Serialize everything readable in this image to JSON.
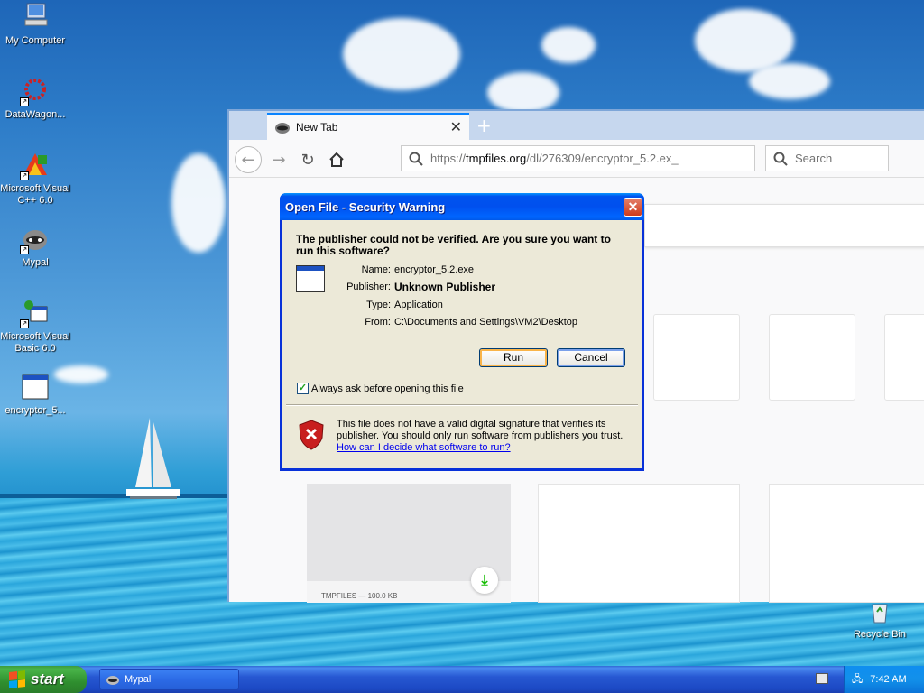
{
  "desktop": {
    "icons": [
      {
        "label": "My Computer",
        "icon": "my-computer-icon"
      },
      {
        "label": "DataWagon...",
        "icon": "datawagon-icon"
      },
      {
        "label": "Microsoft Visual C++ 6.0",
        "icon": "visual-cpp-icon"
      },
      {
        "label": "Mypal",
        "icon": "mypal-icon"
      },
      {
        "label": "Microsoft Visual Basic 6.0",
        "icon": "visual-basic-icon"
      },
      {
        "label": "encryptor_5...",
        "icon": "executable-icon"
      },
      {
        "label": "Recycle Bin",
        "icon": "recycle-bin-icon"
      }
    ]
  },
  "browser": {
    "tab_title": "New Tab",
    "url_prefix": "https://",
    "url_host": "tmpfiles.org",
    "url_path": "/dl/276309/encryptor_5.2.ex_",
    "search_placeholder": "Search",
    "download_tile_caption": "TMPFILES — 100.0 KB"
  },
  "dialog": {
    "title": "Open File - Security Warning",
    "heading": "The publisher could not be verified.  Are you sure you want to run this software?",
    "name_label": "Name:",
    "name_value": "encryptor_5.2.exe",
    "publisher_label": "Publisher:",
    "publisher_value": "Unknown Publisher",
    "type_label": "Type:",
    "type_value": "Application",
    "from_label": "From:",
    "from_value": "C:\\Documents and Settings\\VM2\\Desktop",
    "run_label": "Run",
    "cancel_label": "Cancel",
    "always_ask_label": "Always ask before opening this file",
    "always_ask_checked": true,
    "warning_text": "This file does not have a valid digital signature that verifies its publisher.  You should only run software from publishers you trust.",
    "help_link": "How can I decide what software to run?"
  },
  "taskbar": {
    "start_label": "start",
    "task_item": "Mypal",
    "clock": "7:42 AM"
  },
  "colors": {
    "titlebar": "#0054e3",
    "dialog_bg": "#ece9d8",
    "start_green": "#3a9a3a",
    "taskbar_blue": "#245edb"
  }
}
